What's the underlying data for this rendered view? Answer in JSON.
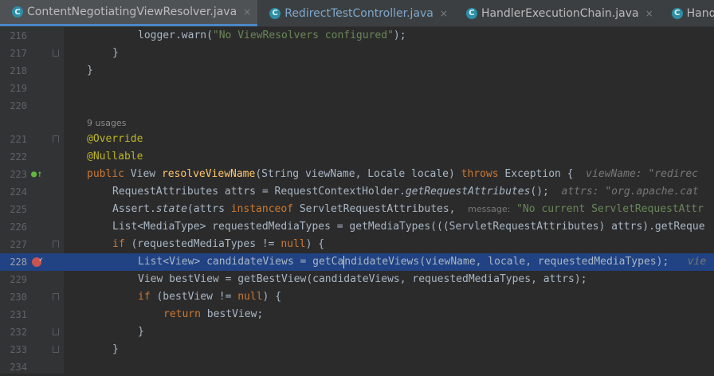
{
  "tabs": [
    {
      "label": "ContentNegotiatingViewResolver.java",
      "icon": "C",
      "close": "×",
      "active": true
    },
    {
      "label": "RedirectTestController.java",
      "icon": "C",
      "close": "×",
      "active": false
    },
    {
      "label": "HandlerExecutionChain.java",
      "icon": "C",
      "close": "×",
      "active": false
    },
    {
      "label": "HandlerM",
      "icon": "C",
      "close": "",
      "active": false
    }
  ],
  "code": {
    "usages": "9 usages",
    "line_numbers": [
      "216",
      "217",
      "218",
      "219",
      "220",
      "221",
      "222",
      "223",
      "224",
      "225",
      "226",
      "227",
      "228",
      "229",
      "230",
      "231",
      "232",
      "233",
      "234"
    ],
    "l216": {
      "a": "logger.warn(",
      "s": "\"No ViewResolvers configured\"",
      "b": ");"
    },
    "l217": "}",
    "l218": "}",
    "l221": "@Override",
    "l222": "@Nullable",
    "l223": {
      "k1": "public",
      "t1": " View ",
      "m": "resolveViewName",
      "t2": "(String viewName, Locale locale) ",
      "k2": "throws",
      "t3": " Exception {",
      "hint": "viewName: \"redirec"
    },
    "l224": {
      "t1": "RequestAttributes attrs = RequestContextHolder.",
      "m": "getRequestAttributes",
      "t2": "();",
      "hint": "attrs: \"org.apache.cat"
    },
    "l225": {
      "t1": "Assert.",
      "m": "state",
      "t2": "(attrs ",
      "k": "instanceof",
      "t3": " ServletRequestAttributes, ",
      "hint_label": "message:",
      "s": "\"No current ServletRequestAttr"
    },
    "l226": {
      "t1": "List<MediaType> requestedMediaTypes = getMediaTypes(((ServletRequestAttributes) attrs).getReque"
    },
    "l227": {
      "k1": "if",
      "t1": " (requestedMediaTypes != ",
      "k2": "null",
      "t2": ") {"
    },
    "l228": {
      "t1": "List<View> candidateViews = getCa",
      "t2": "ndidateViews(viewName, locale, requestedMediaTypes);",
      "hint": "vie"
    },
    "l229": {
      "t1": "View bestView = getBestView(candidateViews, requestedMediaTypes, attrs);"
    },
    "l230": {
      "k1": "if",
      "t1": " (bestView != ",
      "k2": "null",
      "t2": ") {"
    },
    "l231": {
      "k": "return",
      "t1": " bestView;"
    },
    "l232": "}",
    "l233": "}"
  },
  "colors": {
    "breakpoint": "#c75450",
    "current_line": "#214283",
    "keyword": "#cc7832",
    "annotation": "#bbb529",
    "method": "#ffc66d",
    "string": "#6a8759"
  }
}
